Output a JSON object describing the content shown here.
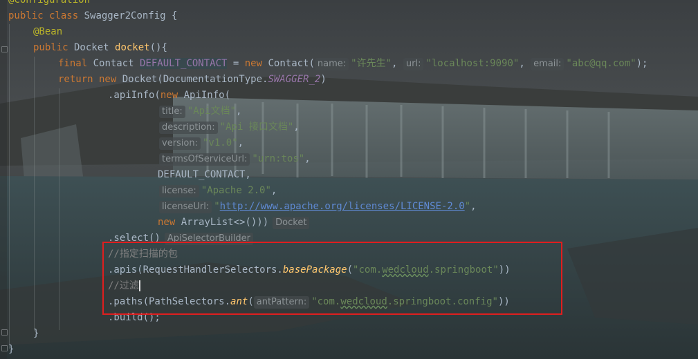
{
  "editor": {
    "lines": {
      "l0": "@Configuration",
      "l1_kw": "public class",
      "l1_name": " Swagger2Config {",
      "l2": "@Bean",
      "l3_kw": "public",
      "l3_type": " Docket ",
      "l3_fn": "docket",
      "l3_rest": "(){",
      "l4_kw1": "final",
      "l4_type": " Contact ",
      "l4_var": "DEFAULT_CONTACT",
      "l4_eq": " = ",
      "l4_new": "new",
      "l4_ctor": " Contact(",
      "l4_hint1": "name:",
      "l4_v1": "\"许先生\"",
      "l4_comma1": ", ",
      "l4_hint2": "url:",
      "l4_v2": "\"localhost:9090\"",
      "l4_comma2": ", ",
      "l4_hint3": "email:",
      "l4_v3": "\"abc@qq.com\"",
      "l4_end": ");",
      "l5_ret": "return new",
      "l5_rest": " Docket(DocumentationType.",
      "l5_const": "SWAGGER_2",
      "l5_end": ")",
      "l6_pre": ".apiInfo(",
      "l6_new": "new",
      "l6_rest": " ApiInfo(",
      "l7_hint": "title:",
      "l7_val": "\"Api文档\"",
      "l8_hint": "description:",
      "l8_val": "\"Api 接口文档\"",
      "l9_hint": "version:",
      "l9_val": "\"v1.0\"",
      "l10_hint": "termsOfServiceUrl:",
      "l10_val": "\"urn:tos\"",
      "l11": "DEFAULT_CONTACT,",
      "l12_hint": "license:",
      "l12_val": "\"Apache 2.0\"",
      "l13_hint": "licenseUrl:",
      "l13_val": "\"http://www.apache.org/licenses/LICENSE-2.0\"",
      "l14_new": "new",
      "l14_rest": " ArrayList<>()))",
      "l14_hint": "Docket",
      "l15_code": ".select()",
      "l15_hint": "ApiSelectorBuilder",
      "l16": "//指定扫描的包",
      "l17_pre": ".apis(RequestHandlerSelectors.",
      "l17_fn": "basePackage",
      "l17_open": "(",
      "l17_val_a": "\"com.",
      "l17_val_b": "wedcloud",
      "l17_val_c": ".springboot\"",
      "l17_end": "))",
      "l18": "//过滤",
      "l19_pre": ".paths(PathSelectors.",
      "l19_fn": "ant",
      "l19_open": "(",
      "l19_hint": "antPattern:",
      "l19_val_a": "\"com.",
      "l19_val_b": "wedcloud",
      "l19_val_c": ".springboot.config\"",
      "l19_end": "))",
      "l20": ".build();",
      "l21": "}",
      "l22": "}"
    }
  },
  "colors": {
    "keyword": "#cc7832",
    "annotation": "#bbb529",
    "method": "#ffc66d",
    "string": "#6a8759",
    "constant": "#9876aa",
    "comment": "#808080",
    "highlight_box": "#e01e1e"
  }
}
